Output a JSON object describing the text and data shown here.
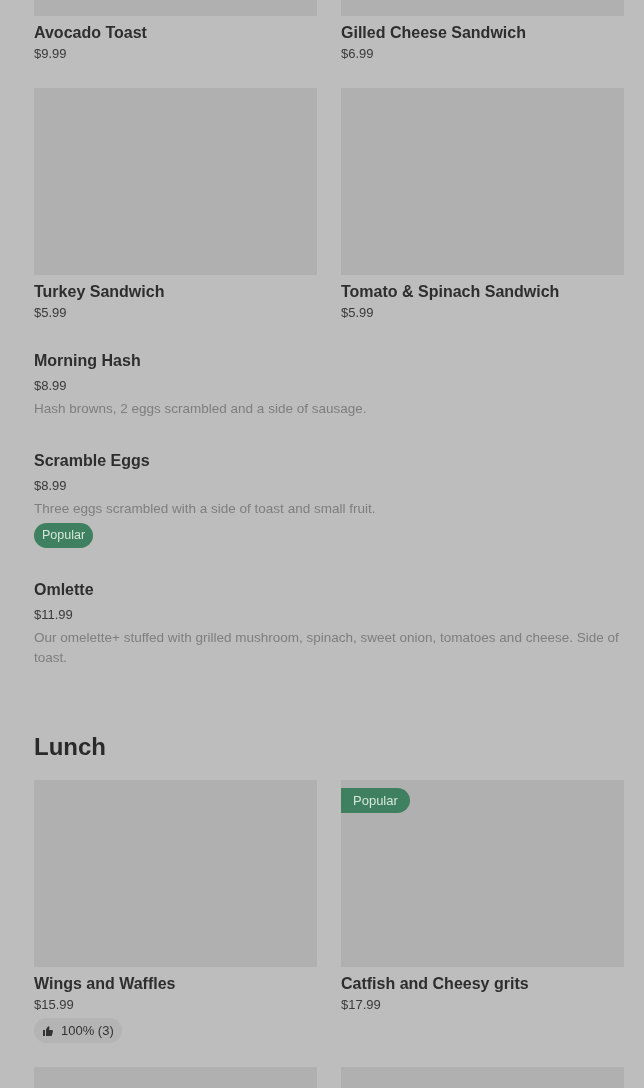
{
  "sections": [
    {
      "kind": "grid",
      "items": [
        {
          "kind": "dish",
          "name": "Avocado Toast",
          "price": "$9.99"
        },
        {
          "kind": "dish",
          "name": "Gilled Cheese Sandwich",
          "price": "$6.99"
        },
        {
          "kind": "dish",
          "name": "Turkey Sandwich",
          "price": "$5.99"
        },
        {
          "kind": "dish",
          "name": "Tomato & Spinach Sandwich",
          "price": "$5.99"
        }
      ]
    },
    {
      "kind": "list",
      "items": [
        {
          "name": "Morning Hash",
          "price": "$8.99",
          "description": "Hash browns, 2 eggs scrambled and a side of sausage."
        },
        {
          "name": "Scramble Eggs",
          "price": "$8.99",
          "description": "Three eggs scrambled with a side of toast and small fruit.",
          "badge": "Popular"
        },
        {
          "name": "Omlette",
          "price": "$11.99",
          "description": "Our omelette+ stuffed with grilled mushroom, spinach, sweet onion, tomatoes and cheese. Side of toast."
        }
      ]
    },
    {
      "kind": "heading",
      "title": "Lunch"
    },
    {
      "kind": "grid",
      "items": [
        {
          "kind": "dish",
          "name": "Wings and Waffles",
          "price": "$15.99",
          "rating": "100% (3)"
        },
        {
          "kind": "dish",
          "name": "Catfish and Cheesy grits",
          "price": "$17.99",
          "badge": "Popular"
        },
        {
          "kind": "image"
        },
        {
          "kind": "image"
        }
      ]
    }
  ]
}
